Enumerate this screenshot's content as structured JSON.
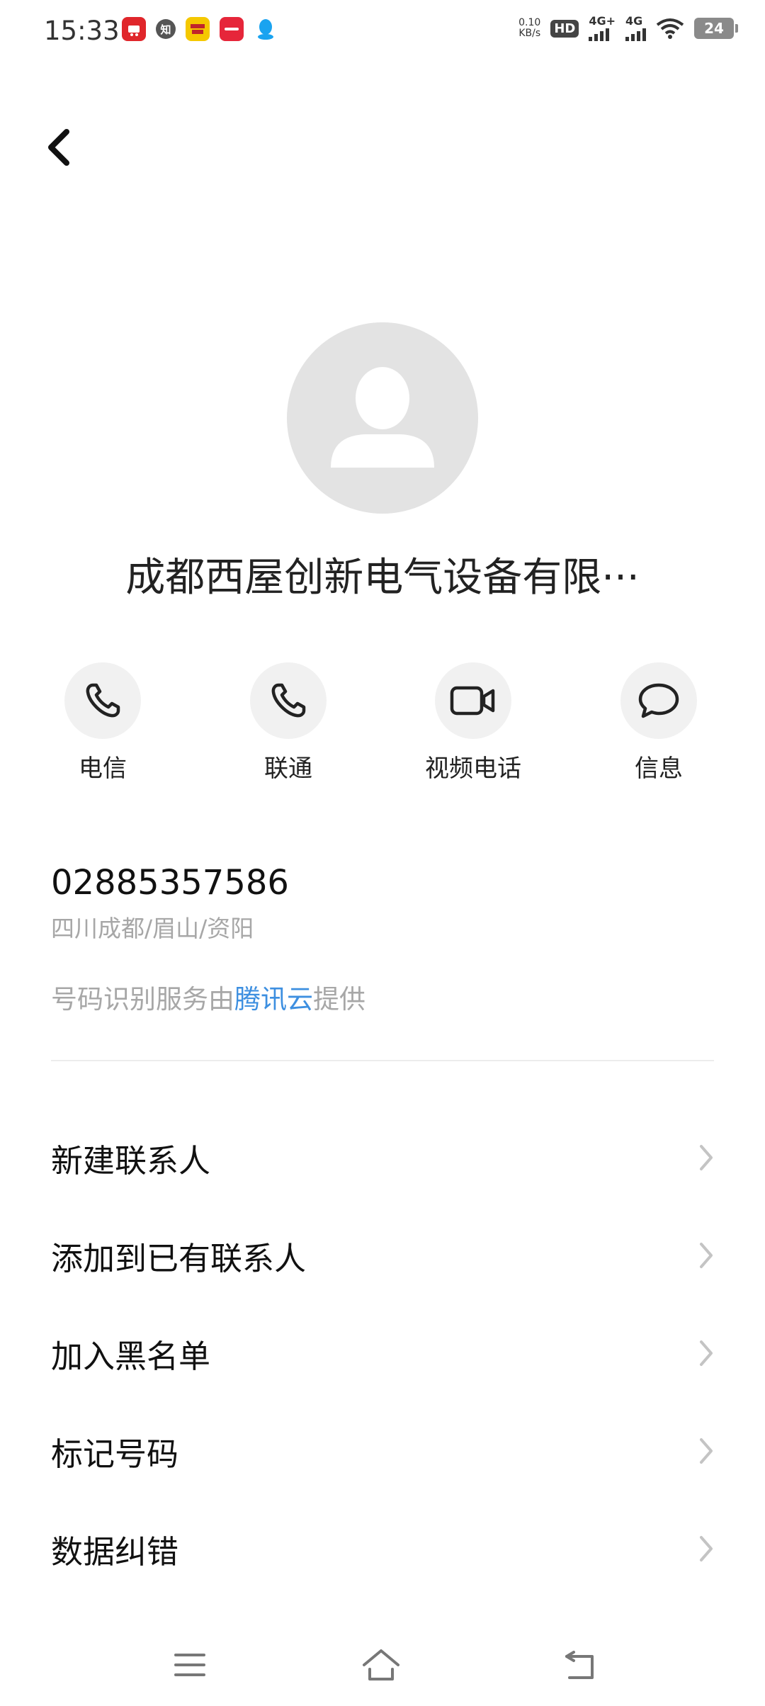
{
  "status_bar": {
    "time": "15:33",
    "net_speed_value": "0.10",
    "net_speed_unit": "KB/s",
    "hd_label": "HD",
    "signal1_label": "4G+",
    "signal2_label": "4G",
    "battery": "24",
    "notif_zhi": "知"
  },
  "contact": {
    "name": "成都西屋创新电气设备有限···"
  },
  "actions": [
    {
      "label": "电信"
    },
    {
      "label": "联通"
    },
    {
      "label": "视频电话"
    },
    {
      "label": "信息"
    }
  ],
  "number": {
    "value": "02885357586",
    "location": "四川成都/眉山/资阳",
    "provider_prefix": "号码识别服务由",
    "provider_name": "腾讯云",
    "provider_suffix": "提供"
  },
  "menu": [
    {
      "label": "新建联系人"
    },
    {
      "label": "添加到已有联系人"
    },
    {
      "label": "加入黑名单"
    },
    {
      "label": "标记号码"
    },
    {
      "label": "数据纠错"
    }
  ],
  "colors": {
    "link": "#3d8fe0",
    "secondary_text": "#a7a7a7",
    "avatar_bg": "#e3e3e3"
  }
}
